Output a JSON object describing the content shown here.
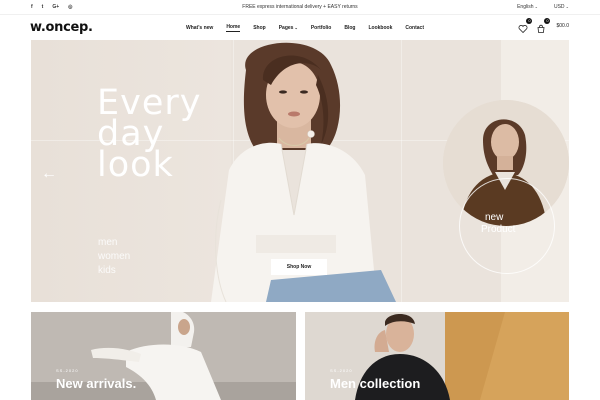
{
  "topbar": {
    "social": [
      {
        "icon": "facebook-icon",
        "glyph": "f"
      },
      {
        "icon": "twitter-icon",
        "glyph": "t"
      },
      {
        "icon": "google-plus-icon",
        "glyph": "G+"
      },
      {
        "icon": "instagram-icon",
        "glyph": "◎"
      }
    ],
    "promo": "FREE express international delivery + EASY returns",
    "language": "English",
    "currency": "USD"
  },
  "header": {
    "logo": "w.oncep.",
    "nav": [
      {
        "label": "What's new"
      },
      {
        "label": "Home",
        "active": true
      },
      {
        "label": "Shop"
      },
      {
        "label": "Pages",
        "dropdown": true
      },
      {
        "label": "Portfolio"
      },
      {
        "label": "Blog"
      },
      {
        "label": "Lookbook"
      },
      {
        "label": "Contact"
      }
    ],
    "wishlist_count": "0",
    "cart_count": "0",
    "cart_total": "$00.0"
  },
  "hero": {
    "title_lines": [
      "Every",
      "day",
      "look"
    ],
    "sub_lines": [
      "men",
      "women",
      "kids"
    ],
    "button": "Shop Now",
    "badge_lines": [
      "new",
      "Product"
    ]
  },
  "cards": [
    {
      "small": "SS-2020",
      "title": "New arrivals."
    },
    {
      "small": "SS-2020",
      "title": "Men collection"
    }
  ],
  "colors": {
    "hero_bg": "#eae3dc",
    "accent": "#111111"
  }
}
